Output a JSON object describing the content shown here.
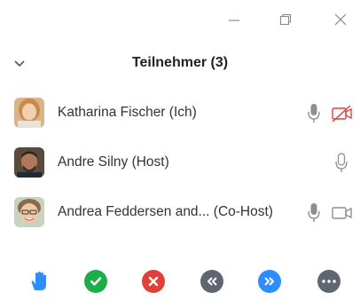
{
  "window": {
    "controls": [
      {
        "name": "minimize-button",
        "icon": "minimize-icon"
      },
      {
        "name": "restore-button",
        "icon": "restore-icon"
      },
      {
        "name": "close-button",
        "icon": "close-icon"
      }
    ]
  },
  "header": {
    "title": "Teilnehmer (3)",
    "collapse_icon": "chevron-down-icon"
  },
  "participants": [
    {
      "name": "Katharina Fischer (Ich)",
      "avatar": "avatar-katharina",
      "mic": "mic-icon",
      "video": "video-off-icon",
      "video_color": "#e0403a"
    },
    {
      "name": "Andre Silny (Host)",
      "avatar": "avatar-andre",
      "mic": "mic-icon",
      "video": null
    },
    {
      "name": "Andrea Feddersen and... (Co-Host)",
      "avatar": "avatar-andrea",
      "mic": "mic-icon",
      "video": "video-icon"
    }
  ],
  "toolbar": {
    "buttons": [
      {
        "name": "raise-hand-button",
        "icon": "hand-icon",
        "color": "#2d8cff"
      },
      {
        "name": "yes-button",
        "icon": "check-icon",
        "color": "#1dad4b"
      },
      {
        "name": "no-button",
        "icon": "x-icon",
        "color": "#e0403a"
      },
      {
        "name": "go-slower-button",
        "icon": "rewind-icon",
        "color": "#5f6670"
      },
      {
        "name": "go-faster-button",
        "icon": "fast-forward-icon",
        "color": "#2d8cff"
      },
      {
        "name": "more-button",
        "icon": "more-icon",
        "color": "#5f6670"
      }
    ]
  }
}
